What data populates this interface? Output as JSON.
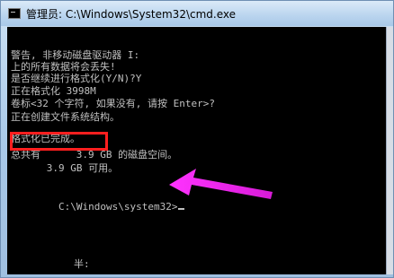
{
  "window": {
    "title": "管理员: C:\\Windows\\System32\\cmd.exe"
  },
  "console": {
    "lines": [
      "警告, 非移动磁盘驱动器 I:",
      "上的所有数据将会丢失!",
      "是否继续进行格式化(Y/N)?Y",
      "正在格式化 3998M",
      "卷标<32 个字符, 如果没有, 请按 Enter>?",
      "正在创建文件系统结构。",
      "格式化已完成。",
      "总共有      3.9 GB 的磁盘空间。",
      "      3.9 GB 可用。",
      "C:\\Windows\\system32>",
      "半:"
    ]
  },
  "colors": {
    "console_bg": "#000000",
    "console_text": "#c0c0c0",
    "highlight": "#ff1f1f",
    "arrow": "#ff33ff"
  }
}
